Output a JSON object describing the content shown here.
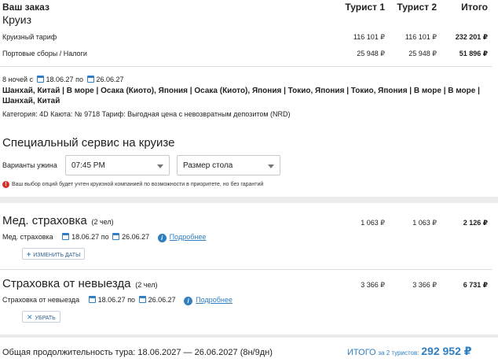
{
  "order": {
    "heading": "Ваш заказ",
    "product": "Круиз",
    "columns": [
      "Турист 1",
      "Турист 2",
      "Итого"
    ],
    "rows": [
      {
        "label": "Круизный тариф",
        "t1": "116 101 ₽",
        "t2": "116 101 ₽",
        "total": "232 201 ₽"
      },
      {
        "label": "Портовые сборы / Налоги",
        "t1": "25 948 ₽",
        "t2": "25 948 ₽",
        "total": "51 896 ₽"
      }
    ]
  },
  "cruise": {
    "nights": "8 ночей с",
    "date_from": "18.06.27",
    "po": "по",
    "date_to": "26.06.27",
    "route_line1": "Шанхай, Китай | В море | Осака (Киото), Япония | Осака (Киото), Япония | Токио, Япония | Токио, Япония | В море | В море |",
    "route_line2": "Шанхай, Китай",
    "details": "Категория: 4D  Каюта: № 9718  Тариф: Выгодная цена с невозвратным депозитом (NRD)"
  },
  "service": {
    "title": "Специальный сервис на круизе",
    "dinner_label": "Варианты ужина",
    "dinner_value": "07:45 PM",
    "table_value": "Размер стола",
    "warning_icon": "!",
    "warning": "Ваш выбор опций будет учтен круизной компанией по возможности в приоритете, но без гарантий"
  },
  "insurance_med": {
    "title": "Мед. страховка",
    "persons": "(2 чел)",
    "t1": "1 063 ₽",
    "t2": "1 063 ₽",
    "total": "2 126 ₽",
    "sub_label": "Мед. страховка",
    "date_from": "18.06.27",
    "po": "по",
    "date_to": "26.06.27",
    "info_icon": "i",
    "more": "Подробнее",
    "button_icon": "+",
    "button": "ИЗМЕНИТЬ ДАТЫ"
  },
  "insurance_cancel": {
    "title": "Страховка от невыезда",
    "persons": "(2 чел)",
    "t1": "3 366 ₽",
    "t2": "3 366 ₽",
    "total": "6 731 ₽",
    "sub_label": "Страховка от невыезда",
    "date_from": "18.06.27",
    "po": "по",
    "date_to": "26.06.27",
    "info_icon": "i",
    "more": "Подробнее",
    "button_icon": "✕",
    "button": "УБРАТЬ"
  },
  "footer": {
    "duration": "Общая продолжительность тура: 18.06.2027 — 26.06.2027 (8н/9дн)",
    "total_label": "ИТОГО",
    "total_sub": "за 2 туристов:",
    "total_value": "292 952 ₽"
  },
  "colors": {
    "accent": "#2f7fc1",
    "warning": "#d9302c",
    "panel_bg": "#ffffff",
    "page_bg": "#ececec"
  }
}
